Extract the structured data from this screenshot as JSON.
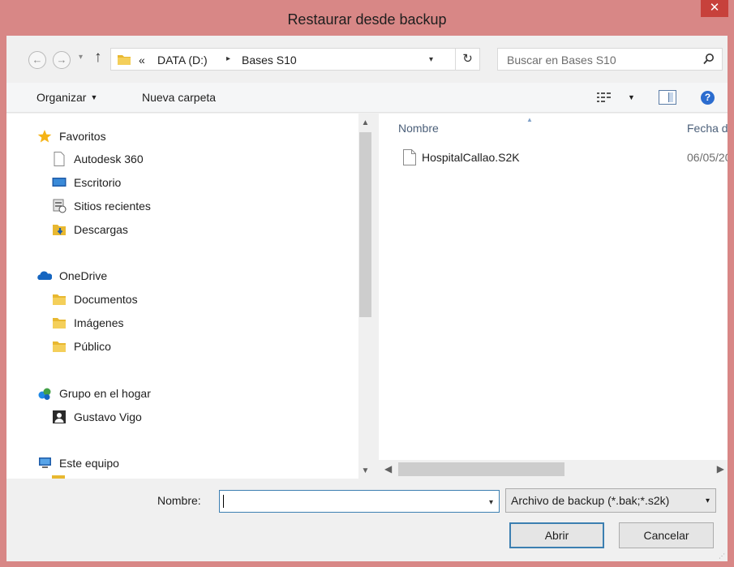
{
  "window": {
    "title": "Restaurar desde backup",
    "close_label": "✕"
  },
  "address": {
    "overflow_label": "«",
    "crumbs": [
      "DATA (D:)",
      "Bases S10"
    ],
    "search_placeholder": "Buscar en Bases S10"
  },
  "toolbar": {
    "organize_label": "Organizar",
    "new_folder_label": "Nueva carpeta"
  },
  "nav": {
    "favorites": "Favoritos",
    "fav_items": [
      "Autodesk 360",
      "Escritorio",
      "Sitios recientes",
      "Descargas"
    ],
    "onedrive": "OneDrive",
    "onedrive_items": [
      "Documentos",
      "Imágenes",
      "Público"
    ],
    "homegroup": "Grupo en el hogar",
    "homegroup_items": [
      "Gustavo Vigo"
    ],
    "this_pc": "Este equipo"
  },
  "columns": {
    "name": "Nombre",
    "date": "Fecha d"
  },
  "files": [
    {
      "name": "HospitalCallao.S2K",
      "date": "06/05/20"
    }
  ],
  "footer": {
    "filename_label": "Nombre:",
    "filename_value": "",
    "filter_label": "Archivo de backup (*.bak;*.s2k)",
    "open_label": "Abrir",
    "cancel_label": "Cancelar"
  },
  "colors": {
    "titlebar": "#d88786",
    "close": "#c7413b",
    "focus": "#3c7fb1",
    "folder": "#e8b830"
  }
}
